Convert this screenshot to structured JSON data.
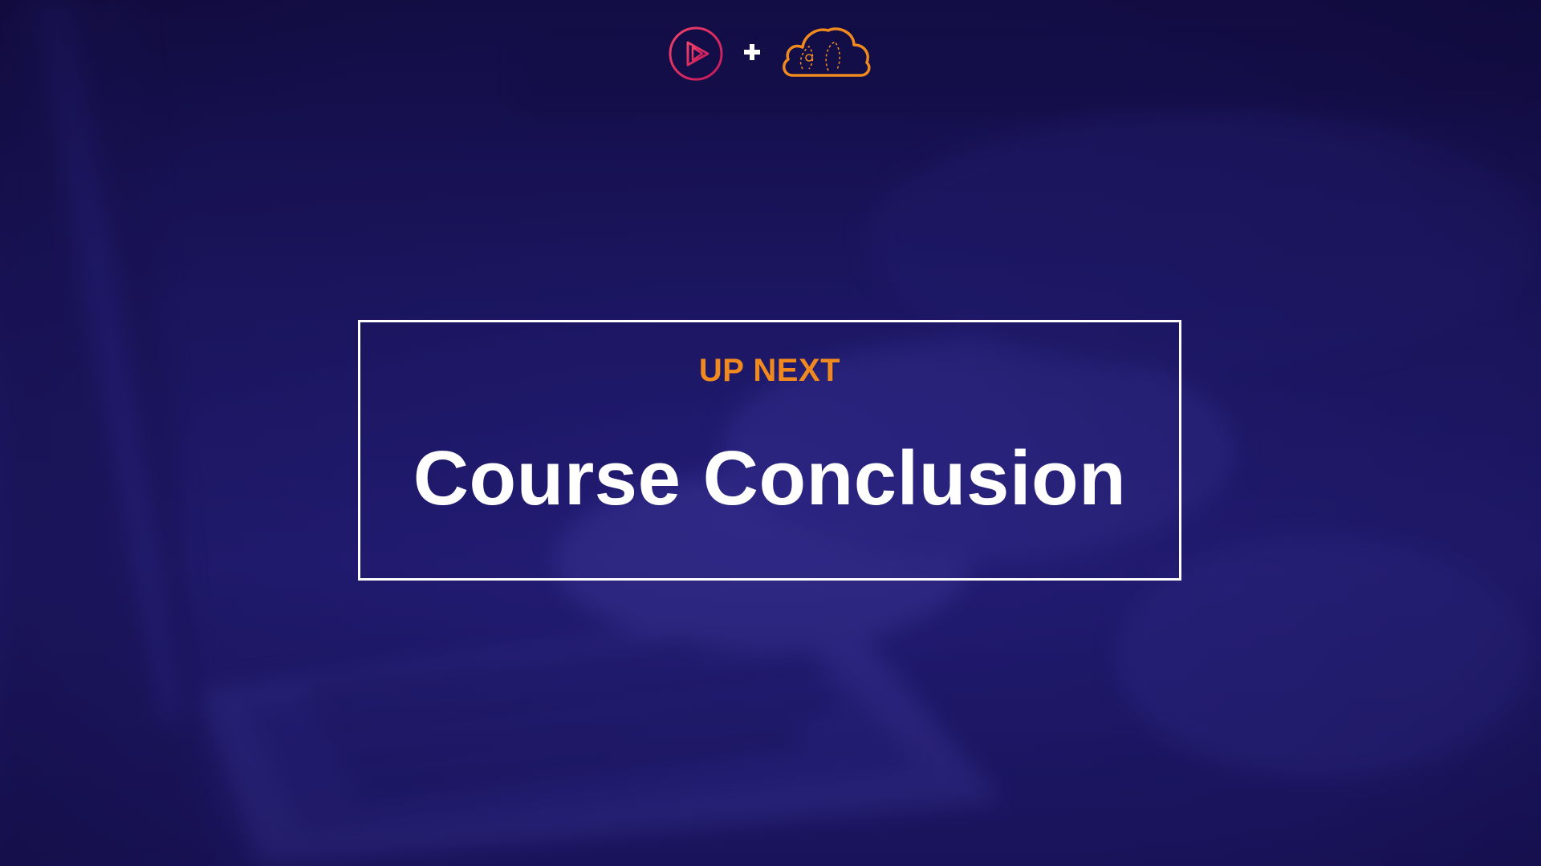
{
  "slide": {
    "eyebrow": "UP NEXT",
    "title": "Course Conclusion"
  },
  "logos": {
    "left_icon": "play-circle-icon",
    "separator": "plus-icon",
    "right_icon": "cloud-icon"
  },
  "colors": {
    "background": "#1d1766",
    "accent_orange": "#f08a1e",
    "accent_pink": "#e8335c",
    "text_white": "#ffffff"
  }
}
